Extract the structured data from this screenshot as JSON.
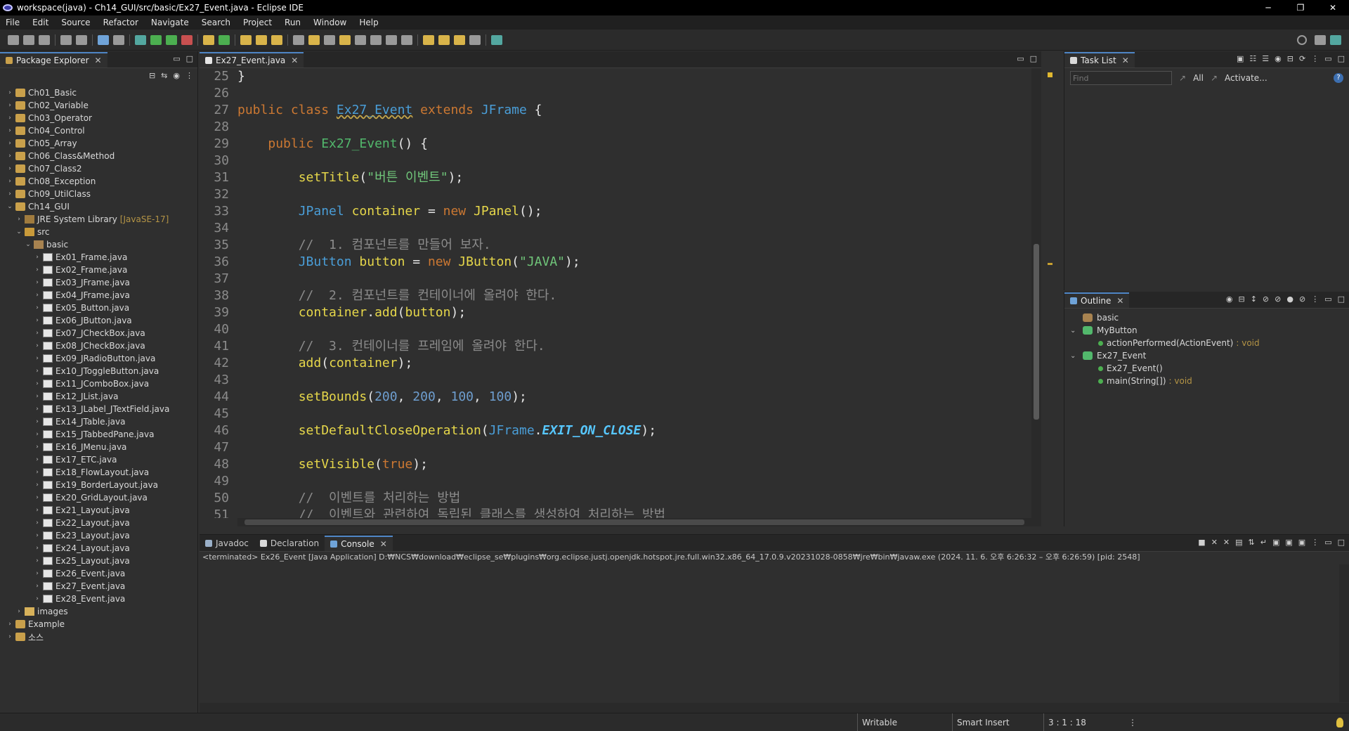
{
  "window": {
    "title": "workspace(java) - Ch14_GUI/src/basic/Ex27_Event.java - Eclipse IDE",
    "controls": [
      "─",
      "❐",
      "✕"
    ]
  },
  "menu": [
    "File",
    "Edit",
    "Source",
    "Refactor",
    "Navigate",
    "Search",
    "Project",
    "Run",
    "Window",
    "Help"
  ],
  "package_explorer": {
    "tab": "Package Explorer",
    "tree": [
      {
        "label": "Ch01_Basic",
        "level": 0,
        "arrow": "›",
        "icon": "project"
      },
      {
        "label": "Ch02_Variable",
        "level": 0,
        "arrow": "›",
        "icon": "project"
      },
      {
        "label": "Ch03_Operator",
        "level": 0,
        "arrow": "›",
        "icon": "project"
      },
      {
        "label": "Ch04_Control",
        "level": 0,
        "arrow": "›",
        "icon": "project"
      },
      {
        "label": "Ch05_Array",
        "level": 0,
        "arrow": "›",
        "icon": "project"
      },
      {
        "label": "Ch06_Class&Method",
        "level": 0,
        "arrow": "›",
        "icon": "project"
      },
      {
        "label": "Ch07_Class2",
        "level": 0,
        "arrow": "›",
        "icon": "project"
      },
      {
        "label": "Ch08_Exception",
        "level": 0,
        "arrow": "›",
        "icon": "project"
      },
      {
        "label": "Ch09_UtilClass",
        "level": 0,
        "arrow": "›",
        "icon": "project"
      },
      {
        "label": "Ch14_GUI",
        "level": 0,
        "arrow": "⌄",
        "icon": "project"
      },
      {
        "label": "JRE System Library",
        "deco": "[JavaSE-17]",
        "level": 1,
        "arrow": "›",
        "icon": "lib"
      },
      {
        "label": "src",
        "level": 1,
        "arrow": "⌄",
        "icon": "src"
      },
      {
        "label": "basic",
        "level": 2,
        "arrow": "⌄",
        "icon": "pkg"
      },
      {
        "label": "Ex01_Frame.java",
        "level": 3,
        "arrow": "›",
        "icon": "java"
      },
      {
        "label": "Ex02_Frame.java",
        "level": 3,
        "arrow": "›",
        "icon": "java"
      },
      {
        "label": "Ex03_JFrame.java",
        "level": 3,
        "arrow": "›",
        "icon": "java"
      },
      {
        "label": "Ex04_JFrame.java",
        "level": 3,
        "arrow": "›",
        "icon": "java"
      },
      {
        "label": "Ex05_Button.java",
        "level": 3,
        "arrow": "›",
        "icon": "java"
      },
      {
        "label": "Ex06_JButton.java",
        "level": 3,
        "arrow": "›",
        "icon": "java"
      },
      {
        "label": "Ex07_JCheckBox.java",
        "level": 3,
        "arrow": "›",
        "icon": "java"
      },
      {
        "label": "Ex08_JCheckBox.java",
        "level": 3,
        "arrow": "›",
        "icon": "java"
      },
      {
        "label": "Ex09_JRadioButton.java",
        "level": 3,
        "arrow": "›",
        "icon": "java"
      },
      {
        "label": "Ex10_JToggleButton.java",
        "level": 3,
        "arrow": "›",
        "icon": "java"
      },
      {
        "label": "Ex11_JComboBox.java",
        "level": 3,
        "arrow": "›",
        "icon": "java"
      },
      {
        "label": "Ex12_JList.java",
        "level": 3,
        "arrow": "›",
        "icon": "java"
      },
      {
        "label": "Ex13_JLabel_JTextField.java",
        "level": 3,
        "arrow": "›",
        "icon": "java"
      },
      {
        "label": "Ex14_JTable.java",
        "level": 3,
        "arrow": "›",
        "icon": "java"
      },
      {
        "label": "Ex15_JTabbedPane.java",
        "level": 3,
        "arrow": "›",
        "icon": "java"
      },
      {
        "label": "Ex16_JMenu.java",
        "level": 3,
        "arrow": "›",
        "icon": "java"
      },
      {
        "label": "Ex17_ETC.java",
        "level": 3,
        "arrow": "›",
        "icon": "java"
      },
      {
        "label": "Ex18_FlowLayout.java",
        "level": 3,
        "arrow": "›",
        "icon": "java"
      },
      {
        "label": "Ex19_BorderLayout.java",
        "level": 3,
        "arrow": "›",
        "icon": "java"
      },
      {
        "label": "Ex20_GridLayout.java",
        "level": 3,
        "arrow": "›",
        "icon": "java"
      },
      {
        "label": "Ex21_Layout.java",
        "level": 3,
        "arrow": "›",
        "icon": "java"
      },
      {
        "label": "Ex22_Layout.java",
        "level": 3,
        "arrow": "›",
        "icon": "java"
      },
      {
        "label": "Ex23_Layout.java",
        "level": 3,
        "arrow": "›",
        "icon": "java"
      },
      {
        "label": "Ex24_Layout.java",
        "level": 3,
        "arrow": "›",
        "icon": "java"
      },
      {
        "label": "Ex25_Layout.java",
        "level": 3,
        "arrow": "›",
        "icon": "java"
      },
      {
        "label": "Ex26_Event.java",
        "level": 3,
        "arrow": "›",
        "icon": "java"
      },
      {
        "label": "Ex27_Event.java",
        "level": 3,
        "arrow": "›",
        "icon": "java"
      },
      {
        "label": "Ex28_Event.java",
        "level": 3,
        "arrow": "›",
        "icon": "java"
      },
      {
        "label": "images",
        "level": 1,
        "arrow": "›",
        "icon": "folder"
      },
      {
        "label": "Example",
        "level": 0,
        "arrow": "›",
        "icon": "project"
      },
      {
        "label": "소스",
        "level": 0,
        "arrow": "›",
        "icon": "project"
      }
    ]
  },
  "editor": {
    "tab": "Ex27_Event.java",
    "lines": [
      {
        "n": "25",
        "tokens": [
          [
            "plain",
            "}"
          ]
        ]
      },
      {
        "n": "26",
        "tokens": []
      },
      {
        "n": "27",
        "tokens": [
          [
            "kw",
            "public class "
          ],
          [
            "cls",
            "Ex27_Event"
          ],
          [
            "kw",
            " extends "
          ],
          [
            "ty",
            "JFrame"
          ],
          [
            "plain",
            " {"
          ]
        ]
      },
      {
        "n": "28",
        "tokens": []
      },
      {
        "n": "29",
        "tokens": [
          [
            "plain",
            "    "
          ],
          [
            "kw",
            "public "
          ],
          [
            "ctor",
            "Ex27_Event"
          ],
          [
            "plain",
            "() {"
          ]
        ]
      },
      {
        "n": "30",
        "tokens": []
      },
      {
        "n": "31",
        "tokens": [
          [
            "plain",
            "        "
          ],
          [
            "fn",
            "setTitle"
          ],
          [
            "plain",
            "("
          ],
          [
            "st",
            "\"버튼 이벤트\""
          ],
          [
            "plain",
            ");"
          ]
        ]
      },
      {
        "n": "32",
        "tokens": []
      },
      {
        "n": "33",
        "tokens": [
          [
            "plain",
            "        "
          ],
          [
            "ty",
            "JPanel"
          ],
          [
            "fn",
            " container"
          ],
          [
            "plain",
            " = "
          ],
          [
            "kw",
            "new "
          ],
          [
            "fn",
            "JPanel"
          ],
          [
            "plain",
            "();"
          ]
        ]
      },
      {
        "n": "34",
        "tokens": []
      },
      {
        "n": "35",
        "tokens": [
          [
            "plain",
            "        "
          ],
          [
            "cm",
            "//  1. 컴포넌트를 만들어 보자."
          ]
        ]
      },
      {
        "n": "36",
        "tokens": [
          [
            "plain",
            "        "
          ],
          [
            "ty",
            "JButton"
          ],
          [
            "fn",
            " button"
          ],
          [
            "plain",
            " = "
          ],
          [
            "kw",
            "new "
          ],
          [
            "fn",
            "JButton"
          ],
          [
            "plain",
            "("
          ],
          [
            "st",
            "\"JAVA\""
          ],
          [
            "plain",
            ");"
          ]
        ]
      },
      {
        "n": "37",
        "tokens": []
      },
      {
        "n": "38",
        "tokens": [
          [
            "plain",
            "        "
          ],
          [
            "cm",
            "//  2. 컴포넌트를 컨테이너에 올려야 한다."
          ]
        ]
      },
      {
        "n": "39",
        "tokens": [
          [
            "plain",
            "        "
          ],
          [
            "fn",
            "container"
          ],
          [
            "plain",
            "."
          ],
          [
            "fn",
            "add"
          ],
          [
            "plain",
            "("
          ],
          [
            "fn",
            "button"
          ],
          [
            "plain",
            ");"
          ]
        ]
      },
      {
        "n": "40",
        "tokens": []
      },
      {
        "n": "41",
        "tokens": [
          [
            "plain",
            "        "
          ],
          [
            "cm",
            "//  3. 컨테이너를 프레임에 올려야 한다."
          ]
        ]
      },
      {
        "n": "42",
        "tokens": [
          [
            "plain",
            "        "
          ],
          [
            "fn",
            "add"
          ],
          [
            "plain",
            "("
          ],
          [
            "fn",
            "container"
          ],
          [
            "plain",
            ");"
          ]
        ]
      },
      {
        "n": "43",
        "tokens": []
      },
      {
        "n": "44",
        "tokens": [
          [
            "plain",
            "        "
          ],
          [
            "fn",
            "setBounds"
          ],
          [
            "plain",
            "("
          ],
          [
            "num",
            "200"
          ],
          [
            "plain",
            ", "
          ],
          [
            "num",
            "200"
          ],
          [
            "plain",
            ", "
          ],
          [
            "num",
            "100"
          ],
          [
            "plain",
            ", "
          ],
          [
            "num",
            "100"
          ],
          [
            "plain",
            ");"
          ]
        ]
      },
      {
        "n": "45",
        "tokens": []
      },
      {
        "n": "46",
        "tokens": [
          [
            "plain",
            "        "
          ],
          [
            "fn",
            "setDefaultCloseOperation"
          ],
          [
            "plain",
            "("
          ],
          [
            "ty",
            "JFrame"
          ],
          [
            "plain",
            "."
          ],
          [
            "fld",
            "EXIT_ON_CLOSE"
          ],
          [
            "plain",
            ");"
          ]
        ]
      },
      {
        "n": "47",
        "tokens": []
      },
      {
        "n": "48",
        "tokens": [
          [
            "plain",
            "        "
          ],
          [
            "fn",
            "setVisible"
          ],
          [
            "plain",
            "("
          ],
          [
            "kw",
            "true"
          ],
          [
            "plain",
            ");"
          ]
        ]
      },
      {
        "n": "49",
        "tokens": []
      },
      {
        "n": "50",
        "tokens": [
          [
            "plain",
            "        "
          ],
          [
            "cm",
            "//  이벤트를 처리하는 방법"
          ]
        ]
      },
      {
        "n": "51",
        "tokens": [
          [
            "plain",
            "        "
          ],
          [
            "cm",
            "//  이벤트와 관련하여 독립된 클래스를 생성하여 처리하는 방법"
          ]
        ]
      }
    ]
  },
  "task_list": {
    "tab": "Task List",
    "find_placeholder": "Find",
    "all_label": "All",
    "activate_label": "Activate..."
  },
  "outline": {
    "tab": "Outline",
    "items": [
      {
        "label": "basic",
        "level": 0,
        "arrow": "",
        "icon": "pkg"
      },
      {
        "label": "MyButton",
        "level": 0,
        "arrow": "⌄",
        "icon": "class"
      },
      {
        "label": "actionPerformed(ActionEvent)",
        "ret": ": void",
        "level": 1,
        "arrow": "",
        "icon": "method"
      },
      {
        "label": "Ex27_Event",
        "level": 0,
        "arrow": "⌄",
        "icon": "class"
      },
      {
        "label": "Ex27_Event()",
        "level": 1,
        "arrow": "",
        "icon": "method"
      },
      {
        "label": "main(String[])",
        "ret": ": void",
        "level": 1,
        "arrow": "",
        "icon": "method"
      }
    ]
  },
  "console": {
    "tabs": [
      "Javadoc",
      "Declaration",
      "Console"
    ],
    "status": "<terminated> Ex26_Event [Java Application] D:₩NCS₩download₩eclipse_se₩plugins₩org.eclipse.justj.openjdk.hotspot.jre.full.win32.x86_64_17.0.9.v20231028-0858₩jre₩bin₩javaw.exe  (2024. 11. 6. 오후 6:26:32 – 오후 6:26:59) [pid: 2548]"
  },
  "statusbar": {
    "writable": "Writable",
    "insert_mode": "Smart Insert",
    "position": "3 : 1 : 18"
  },
  "colors": {
    "accent": "#4f86c6",
    "background": "#2f2f2f",
    "keyword": "#cc7832",
    "type": "#4a9ed8",
    "string": "#70c67a"
  }
}
